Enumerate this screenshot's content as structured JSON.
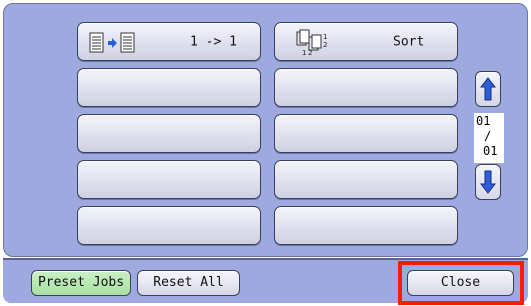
{
  "grid": {
    "buttons": [
      {
        "label": "1 -> 1",
        "icon": "single-to-single-page-icon"
      },
      {
        "label": "Sort",
        "icon": "sort-stack-icon"
      },
      {
        "label": ""
      },
      {
        "label": ""
      },
      {
        "label": ""
      },
      {
        "label": ""
      },
      {
        "label": ""
      },
      {
        "label": ""
      },
      {
        "label": ""
      },
      {
        "label": ""
      }
    ]
  },
  "scroll": {
    "up_icon": "arrow-up-icon",
    "down_icon": "arrow-down-icon",
    "page_current": "01",
    "page_sep": "/",
    "page_total": "01"
  },
  "footer": {
    "preset_jobs": "Preset Jobs",
    "reset_all": "Reset All",
    "close": "Close"
  },
  "colors": {
    "panel": "#9ea9df",
    "preset_button": "#b9e8b4",
    "highlight": "#ff1a00"
  }
}
